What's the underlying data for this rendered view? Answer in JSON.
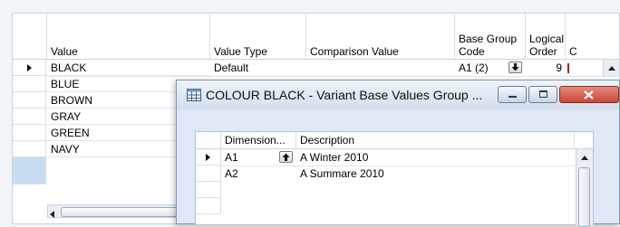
{
  "table": {
    "headers": {
      "value": "Value",
      "value_type": "Value Type",
      "comparison_value": "Comparison Value",
      "base_group_code_line1": "Base Group",
      "base_group_code_line2": "Code",
      "logical_order_line1": "Logical",
      "logical_order_line2": "Order",
      "c": "C"
    },
    "rows": [
      {
        "value": "BLACK",
        "value_type": "Default",
        "base_group_code": "A1 (2)",
        "logical_order": "9"
      },
      {
        "value": "BLUE"
      },
      {
        "value": "BROWN"
      },
      {
        "value": "GRAY"
      },
      {
        "value": "GREEN"
      },
      {
        "value": "NAVY"
      }
    ]
  },
  "dialog": {
    "title": "COLOUR BLACK - Variant Base Values Group ...",
    "headers": {
      "dimension": "Dimension...",
      "description": "Description"
    },
    "rows": [
      {
        "dimension": "A1",
        "description": "A Winter 2010"
      },
      {
        "dimension": "A2",
        "description": "A Summare 2010"
      }
    ]
  },
  "colors": {
    "close_button": "#c9483a",
    "selection_row": "#c7dcf3"
  },
  "icons": {
    "app": "table-icon",
    "lookup": "up-arrow-icon",
    "dropdown": "down-arrow-icon"
  }
}
